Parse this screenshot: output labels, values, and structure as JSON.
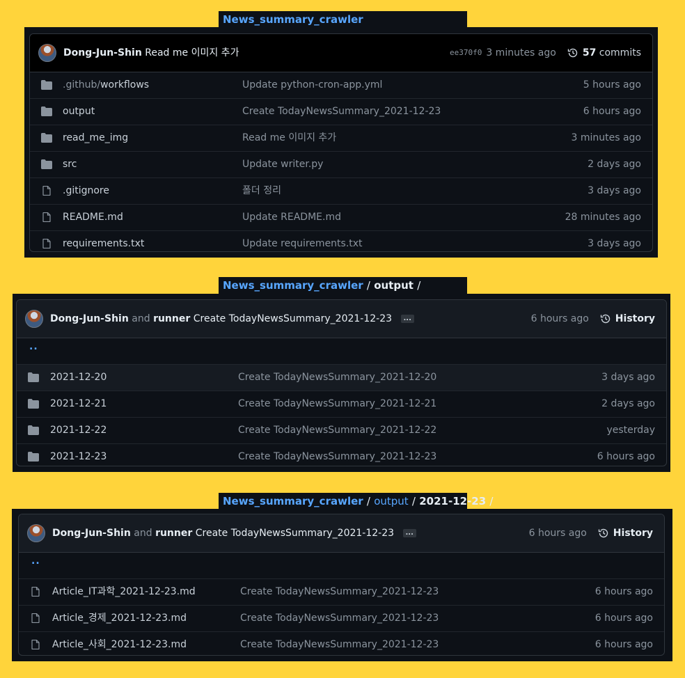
{
  "panel1": {
    "breadcrumb": {
      "repo": "News_summary_crawler"
    },
    "commit": {
      "author": "Dong-Jun-Shin",
      "message": "Read me 이미지 추가",
      "sha": "ee370f0",
      "time": "3 minutes ago",
      "commit_count": "57",
      "commit_label": "commits"
    },
    "rows": [
      {
        "type": "folder",
        "name_prefix": ".github/",
        "name": "workflows",
        "message": "Update python-cron-app.yml",
        "time": "5 hours ago"
      },
      {
        "type": "folder",
        "name_prefix": "",
        "name": "output",
        "message": "Create TodayNewsSummary_2021-12-23",
        "time": "6 hours ago"
      },
      {
        "type": "folder",
        "name_prefix": "",
        "name": "read_me_img",
        "message": "Read me 이미지 추가",
        "time": "3 minutes ago"
      },
      {
        "type": "folder",
        "name_prefix": "",
        "name": "src",
        "message": "Update writer.py",
        "time": "2 days ago"
      },
      {
        "type": "file",
        "name_prefix": "",
        "name": ".gitignore",
        "message": "폴더 정리",
        "time": "3 days ago"
      },
      {
        "type": "file",
        "name_prefix": "",
        "name": "README.md",
        "message": "Update README.md",
        "time": "28 minutes ago"
      },
      {
        "type": "file",
        "name_prefix": "",
        "name": "requirements.txt",
        "message": "Update requirements.txt",
        "time": "3 days ago"
      }
    ]
  },
  "panel2": {
    "breadcrumb": {
      "repo": "News_summary_crawler",
      "sep": "/",
      "current": "output",
      "trail": "/"
    },
    "commit": {
      "author": "Dong-Jun-Shin",
      "and": "and",
      "coauthor": "runner",
      "message": "Create TodayNewsSummary_2021-12-23",
      "ellipsis": "...",
      "time": "6 hours ago",
      "history": "History"
    },
    "up": "..",
    "rows": [
      {
        "type": "folder",
        "name": "2021-12-20",
        "message": "Create TodayNewsSummary_2021-12-20",
        "time": "3 days ago"
      },
      {
        "type": "folder",
        "name": "2021-12-21",
        "message": "Create TodayNewsSummary_2021-12-21",
        "time": "2 days ago"
      },
      {
        "type": "folder",
        "name": "2021-12-22",
        "message": "Create TodayNewsSummary_2021-12-22",
        "time": "yesterday"
      },
      {
        "type": "folder",
        "name": "2021-12-23",
        "message": "Create TodayNewsSummary_2021-12-23",
        "time": "6 hours ago"
      }
    ]
  },
  "panel3": {
    "breadcrumb": {
      "repo": "News_summary_crawler",
      "sep1": "/",
      "folder": "output",
      "sep2": "/",
      "current": "2021-12-23",
      "trail": "/"
    },
    "commit": {
      "author": "Dong-Jun-Shin",
      "and": "and",
      "coauthor": "runner",
      "message": "Create TodayNewsSummary_2021-12-23",
      "ellipsis": "...",
      "time": "6 hours ago",
      "history": "History"
    },
    "up": "..",
    "rows": [
      {
        "type": "file",
        "name": "Article_IT과학_2021-12-23.md",
        "message": "Create TodayNewsSummary_2021-12-23",
        "time": "6 hours ago"
      },
      {
        "type": "file",
        "name": "Article_경제_2021-12-23.md",
        "message": "Create TodayNewsSummary_2021-12-23",
        "time": "6 hours ago"
      },
      {
        "type": "file",
        "name": "Article_사회_2021-12-23.md",
        "message": "Create TodayNewsSummary_2021-12-23",
        "time": "6 hours ago"
      }
    ]
  },
  "colors": {
    "page_bg": "#ffd43b",
    "panel_bg": "#0d1117",
    "link": "#58a6ff",
    "muted": "#8b949e"
  }
}
